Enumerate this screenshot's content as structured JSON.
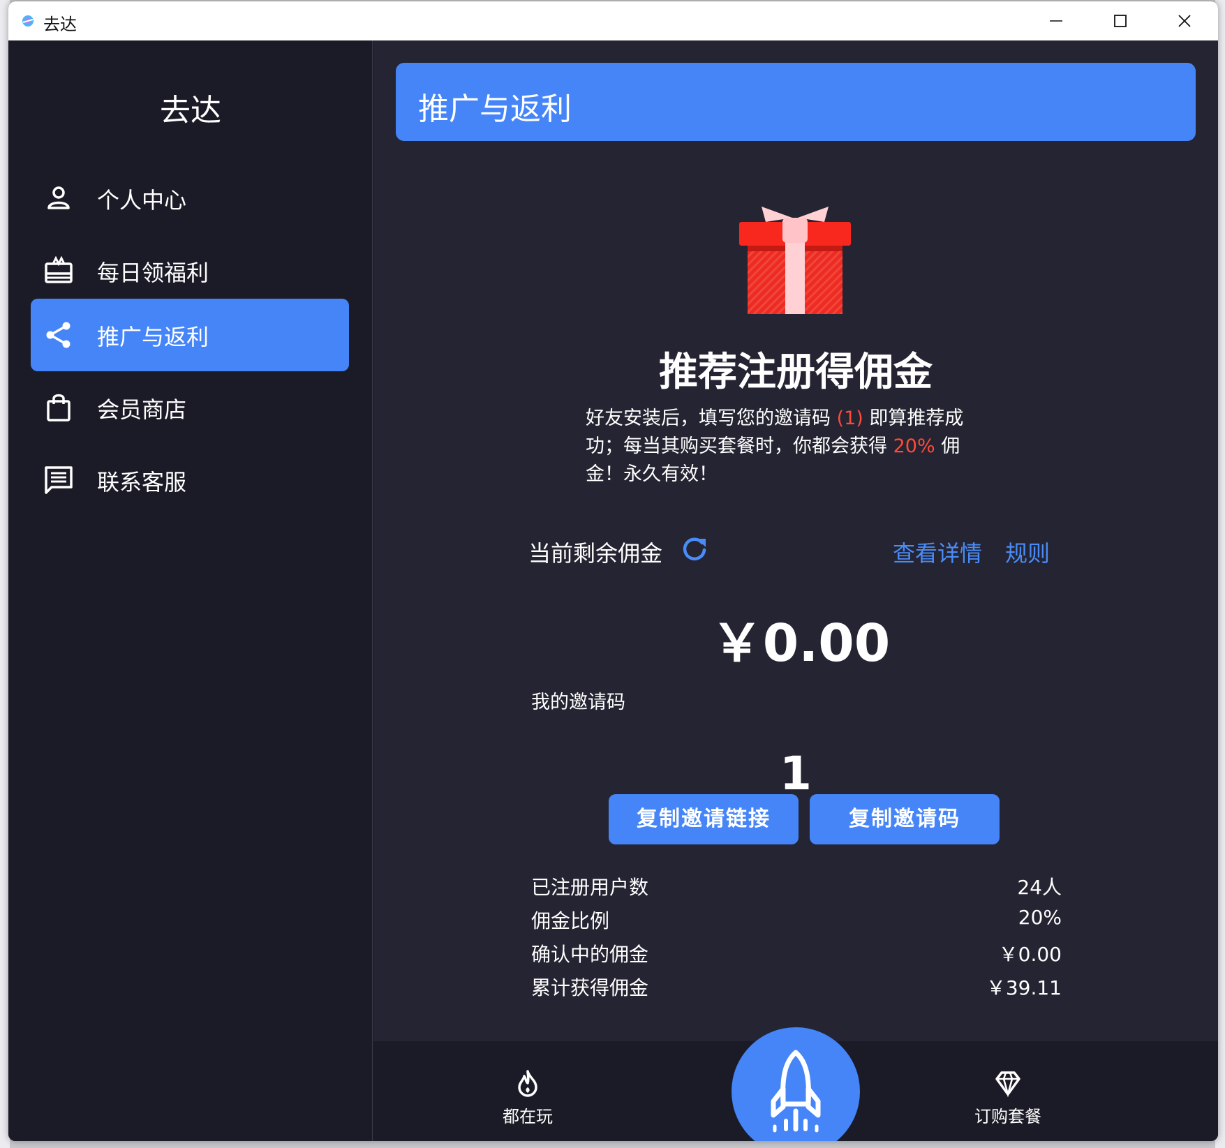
{
  "window": {
    "title": "去达"
  },
  "sidebar": {
    "brand": "去达",
    "items": [
      {
        "label": "个人中心",
        "icon": "person-icon",
        "active": false
      },
      {
        "label": "每日领福利",
        "icon": "gift-card-icon",
        "active": false
      },
      {
        "label": "推广与返利",
        "icon": "share-icon",
        "active": true
      },
      {
        "label": "会员商店",
        "icon": "shopping-bag-icon",
        "active": false
      },
      {
        "label": "联系客服",
        "icon": "chat-icon",
        "active": false
      }
    ]
  },
  "page": {
    "title": "推广与返利",
    "headline": "推荐注册得佣金",
    "desc": {
      "part1": "好友安装后，填写您的邀请码 ",
      "code_hl": "(1)",
      "part2": " 即算推荐成功；每当其购买套餐时，你都会获得 ",
      "rate_hl": "20%",
      "part3": " 佣金！永久有效！"
    },
    "balance": {
      "label": "当前剩余佣金",
      "value": "￥0.00",
      "detail_link": "查看详情",
      "rule_link": "规则"
    },
    "invite": {
      "label": "我的邀请码",
      "code": "1",
      "copy_link_button": "复制邀请链接",
      "copy_code_button": "复制邀请码"
    },
    "stats": [
      {
        "label": "已注册用户数",
        "value": "24人"
      },
      {
        "label": "佣金比例",
        "value": "20%"
      },
      {
        "label": "确认中的佣金",
        "value": "￥0.00"
      },
      {
        "label": "累计获得佣金",
        "value": "￥39.11"
      }
    ]
  },
  "bottom_nav": {
    "left": {
      "label": "都在玩",
      "icon": "flame-icon"
    },
    "center": {
      "icon": "rocket-icon"
    },
    "right": {
      "label": "订购套餐",
      "icon": "diamond-icon"
    }
  },
  "colors": {
    "accent": "#4585f8",
    "highlight": "#ff4b3a",
    "sidebar_bg": "#1b1b27",
    "main_bg": "#242432"
  }
}
